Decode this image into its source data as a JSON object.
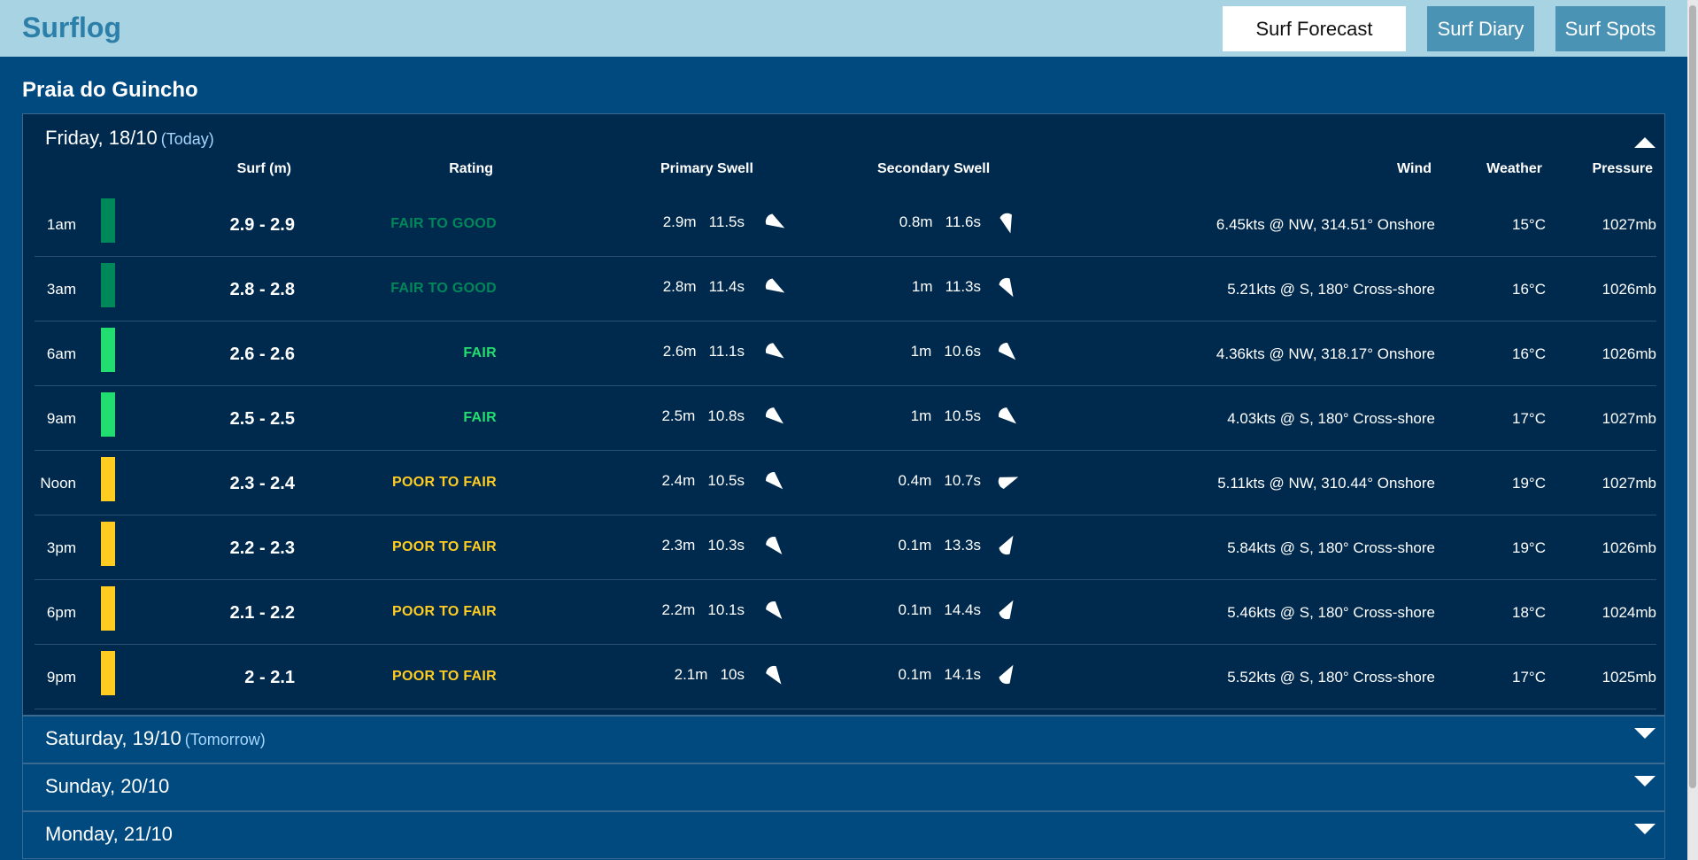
{
  "app": {
    "title": "Surflog"
  },
  "nav": {
    "forecast": "Surf Forecast",
    "diary": "Surf Diary",
    "spots": "Surf Spots"
  },
  "spot": {
    "name": "Praia do Guincho"
  },
  "colors": {
    "fair_to_good": "#00875a",
    "fair": "#22dd70",
    "poor_to_fair": "#ffcc22",
    "panel": "#002a4d",
    "page": "#004a80",
    "header": "#a8d3e3"
  },
  "today": {
    "label": "Friday, 18/10",
    "tag": "(Today)",
    "columns": {
      "surf": "Surf (m)",
      "rating": "Rating",
      "primary": "Primary Swell",
      "secondary": "Secondary Swell",
      "wind": "Wind",
      "weather": "Weather",
      "pressure": "Pressure"
    },
    "rows": [
      {
        "time": "1am",
        "surf": "2.9 - 2.9",
        "rating": "FAIR TO GOOD",
        "rating_key": "fair_to_good",
        "p_h": "2.9m",
        "p_p": "11.5s",
        "p_dir": 300,
        "s_h": "0.8m",
        "s_p": "11.6s",
        "s_dir": 345,
        "wind": "6.45kts @ NW, 314.51° Onshore",
        "weather": "15°C",
        "pressure": "1027mb"
      },
      {
        "time": "3am",
        "surf": "2.8 - 2.8",
        "rating": "FAIR TO GOOD",
        "rating_key": "fair_to_good",
        "p_h": "2.8m",
        "p_p": "11.4s",
        "p_dir": 300,
        "s_h": "1m",
        "s_p": "11.3s",
        "s_dir": 330,
        "wind": "5.21kts @ S, 180° Cross-shore",
        "weather": "16°C",
        "pressure": "1026mb"
      },
      {
        "time": "6am",
        "surf": "2.6 - 2.6",
        "rating": "FAIR",
        "rating_key": "fair",
        "p_h": "2.6m",
        "p_p": "11.1s",
        "p_dir": 305,
        "s_h": "1m",
        "s_p": "10.6s",
        "s_dir": 315,
        "wind": "4.36kts @ NW, 318.17° Onshore",
        "weather": "16°C",
        "pressure": "1026mb"
      },
      {
        "time": "9am",
        "surf": "2.5 - 2.5",
        "rating": "FAIR",
        "rating_key": "fair",
        "p_h": "2.5m",
        "p_p": "10.8s",
        "p_dir": 310,
        "s_h": "1m",
        "s_p": "10.5s",
        "s_dir": 310,
        "wind": "4.03kts @ S, 180° Cross-shore",
        "weather": "17°C",
        "pressure": "1027mb"
      },
      {
        "time": "Noon",
        "surf": "2.3 - 2.4",
        "rating": "POOR TO FAIR",
        "rating_key": "poor_to_fair",
        "p_h": "2.4m",
        "p_p": "10.5s",
        "p_dir": 315,
        "s_h": "0.4m",
        "s_p": "10.7s",
        "s_dir": 250,
        "wind": "5.11kts @ NW, 310.44° Onshore",
        "weather": "19°C",
        "pressure": "1027mb"
      },
      {
        "time": "3pm",
        "surf": "2.2 - 2.3",
        "rating": "POOR TO FAIR",
        "rating_key": "poor_to_fair",
        "p_h": "2.3m",
        "p_p": "10.3s",
        "p_dir": 320,
        "s_h": "0.1m",
        "s_p": "13.3s",
        "s_dir": 210,
        "wind": "5.84kts @ S, 180° Cross-shore",
        "weather": "19°C",
        "pressure": "1026mb"
      },
      {
        "time": "6pm",
        "surf": "2.1 - 2.2",
        "rating": "POOR TO FAIR",
        "rating_key": "poor_to_fair",
        "p_h": "2.2m",
        "p_p": "10.1s",
        "p_dir": 320,
        "s_h": "0.1m",
        "s_p": "14.4s",
        "s_dir": 210,
        "wind": "5.46kts @ S, 180° Cross-shore",
        "weather": "18°C",
        "pressure": "1024mb"
      },
      {
        "time": "9pm",
        "surf": "2 - 2.1",
        "rating": "POOR TO FAIR",
        "rating_key": "poor_to_fair",
        "p_h": "2.1m",
        "p_p": "10s",
        "p_dir": 325,
        "s_h": "0.1m",
        "s_p": "14.1s",
        "s_dir": 210,
        "wind": "5.52kts @ S, 180° Cross-shore",
        "weather": "17°C",
        "pressure": "1025mb"
      }
    ]
  },
  "days": [
    {
      "label": "Saturday, 19/10",
      "tag": "(Tomorrow)"
    },
    {
      "label": "Sunday, 20/10",
      "tag": ""
    },
    {
      "label": "Monday, 21/10",
      "tag": ""
    }
  ],
  "icons": {
    "collapse": "chevron-up-icon",
    "expand": "chevron-down-icon",
    "swell": "swell-direction-icon"
  }
}
